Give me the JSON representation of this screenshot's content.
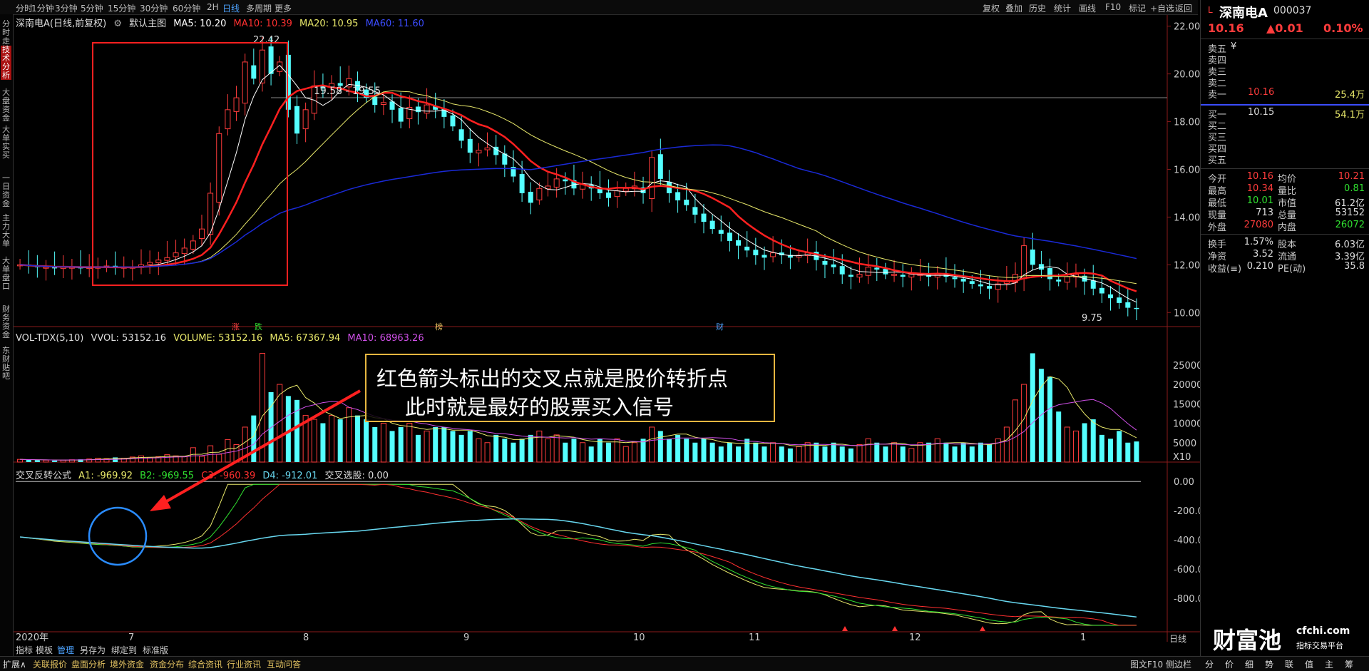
{
  "toolbar": {
    "periods": [
      "分时",
      "1分钟",
      "3分钟",
      "5分钟",
      "15分钟",
      "30分钟",
      "60分钟",
      "2H",
      "日线",
      "多周期",
      "更多"
    ],
    "active_period": "日线",
    "right_buttons": [
      "复权",
      "叠加",
      "历史",
      "统计",
      "画线",
      "F10",
      "标记",
      "+自选",
      "返回"
    ]
  },
  "side_nav": [
    "分时走势",
    "技术分析",
    "大盘资金",
    "大单实买",
    "一日资金",
    "主力大单",
    "大单盘口",
    "财务资金",
    "东财贴吧"
  ],
  "side_nav_active": "技术分析",
  "main_legend": {
    "stock": "深南电A(日线,前复权)",
    "mode": "默认主图",
    "ma5": "MA5: 10.20",
    "ma10": "MA10: 10.39",
    "ma20": "MA20: 10.95",
    "ma60": "MA60: 11.60"
  },
  "price_axis": [
    "22.00",
    "20.00",
    "18.00",
    "16.00",
    "14.00",
    "12.00",
    "10.00"
  ],
  "price_annotations": {
    "high": "22.42",
    "range": "19.58 - 19.55",
    "low": "9.75"
  },
  "event_markers": [
    "涨",
    "跌",
    "榜",
    "财"
  ],
  "vol_legend": {
    "name": "VOL-TDX(5,10)",
    "vvol": "VVOL: 53152.16",
    "volume": "VOLUME: 53152.16",
    "ma5": "MA5: 67367.94",
    "ma10": "MA10: 68963.26"
  },
  "vol_axis": [
    "25000",
    "20000",
    "15000",
    "10000",
    "5000",
    "X10"
  ],
  "ind_legend": {
    "name": "交叉反转公式",
    "a1": "A1: -969.92",
    "b2": "B2: -969.55",
    "c3": "C3: -960.39",
    "d4": "D4: -912.01",
    "pick": "交叉选股: 0.00"
  },
  "ind_axis": [
    "0.00",
    "-200.0",
    "-400.0",
    "-600.0",
    "-800.0"
  ],
  "date_axis": [
    "2020年",
    "7",
    "8",
    "9",
    "10",
    "11",
    "12",
    "1"
  ],
  "period_label": "日线",
  "bottom_tabs": [
    "指标",
    "模板",
    "管理",
    "另存为",
    "绑定到",
    "标准版"
  ],
  "bottom_tabs_active": "管理",
  "annotation": {
    "line1": "红色箭头标出的交叉点就是股价转折点",
    "line2": "此时就是最好的股票买入信号"
  },
  "quote": {
    "name": "深南电A",
    "code": "000037",
    "market": "L",
    "price": "10.16",
    "change": "▲0.01",
    "change_pct": "0.10%",
    "asks": [
      {
        "label": "卖五",
        "price": "",
        "vol": ""
      },
      {
        "label": "卖四",
        "price": "",
        "vol": ""
      },
      {
        "label": "卖三",
        "price": "",
        "vol": ""
      },
      {
        "label": "卖二",
        "price": "",
        "vol": ""
      },
      {
        "label": "卖一",
        "price": "10.16",
        "vol": "25.4万"
      }
    ],
    "ask_unit": "¥",
    "bids": [
      {
        "label": "买一",
        "price": "10.15",
        "vol": "54.1万"
      },
      {
        "label": "买二",
        "price": "",
        "vol": ""
      },
      {
        "label": "买三",
        "price": "",
        "vol": ""
      },
      {
        "label": "买四",
        "price": "",
        "vol": ""
      },
      {
        "label": "买五",
        "price": "",
        "vol": ""
      }
    ],
    "stats": [
      {
        "k1": "今开",
        "v1": "10.16",
        "k2": "均价",
        "v2": "10.21"
      },
      {
        "k1": "最高",
        "v1": "10.34",
        "k2": "量比",
        "v2": "0.81"
      },
      {
        "k1": "最低",
        "v1": "10.01",
        "k2": "市值",
        "v2": "61.2亿"
      },
      {
        "k1": "现量",
        "v1": "713",
        "k2": "总量",
        "v2": "53152"
      },
      {
        "k1": "外盘",
        "v1": "27080",
        "k2": "内盘",
        "v2": "26072"
      }
    ],
    "stats2": [
      {
        "k1": "换手",
        "v1": "1.57%",
        "k2": "股本",
        "v2": "6.03亿"
      },
      {
        "k1": "净资",
        "v1": "3.52",
        "k2": "流通",
        "v2": "3.39亿"
      },
      {
        "k1": "收益(≡)",
        "v1": "0.210",
        "k2": "PE(动)",
        "v2": "35.8"
      }
    ]
  },
  "logo": {
    "text": "财富池",
    "url": "cfchi.com",
    "slogan": "指标交易平台"
  },
  "status_bar": [
    "扩展∧",
    "关联报价",
    "盘面分析",
    "境外资金",
    "资金分布",
    "综合资讯",
    "行业资讯",
    "互动问答"
  ],
  "status_right": "图文F10 侧边栏",
  "right_tabs": [
    "分",
    "价",
    "细",
    "势",
    "联",
    "值",
    "主",
    "筹"
  ],
  "colors": {
    "up": "#ff3c3c",
    "down": "#54ffff",
    "ma5": "#ffffff",
    "ma10": "#ff2020",
    "ma20": "#e8e86a",
    "ma60": "#1a2ad8",
    "accent": "#4da3ff",
    "gold": "#e6b640"
  },
  "chart_data": {
    "type": "candlestick",
    "note_period": "2020-06 to 2021-01 daily",
    "price_ylim": [
      9.5,
      22.5
    ],
    "close_series": [
      12.0,
      11.95,
      11.9,
      11.9,
      11.85,
      11.9,
      11.9,
      11.85,
      11.9,
      11.9,
      11.95,
      11.9,
      11.9,
      11.9,
      12.0,
      12.1,
      12.2,
      12.3,
      12.5,
      12.7,
      13.0,
      13.5,
      15.0,
      17.5,
      18.5,
      19.0,
      20.5,
      19.8,
      21.0,
      20.0,
      20.5,
      18.5,
      17.5,
      18.5,
      19.5,
      19.4,
      19.6,
      19.5,
      19.8,
      19.3,
      19.0,
      18.7,
      18.8,
      18.5,
      18.0,
      18.6,
      18.4,
      18.7,
      18.5,
      18.2,
      17.8,
      17.2,
      16.7,
      16.8,
      16.9,
      16.6,
      16.2,
      15.7,
      15.0,
      14.6,
      15.2,
      15.3,
      15.6,
      15.5,
      15.2,
      15.4,
      15.2,
      15.0,
      14.8,
      15.1,
      15.2,
      15.3,
      15.0,
      16.5,
      15.6,
      15.0,
      14.7,
      14.5,
      14.1,
      13.8,
      13.5,
      13.3,
      13.0,
      12.8,
      12.6,
      12.4,
      12.3,
      12.5,
      12.4,
      12.3,
      12.4,
      12.5,
      12.2,
      12.0,
      11.9,
      11.6,
      11.5,
      11.6,
      11.9,
      11.8,
      11.6,
      11.6,
      11.5,
      11.6,
      11.6,
      11.5,
      11.6,
      11.5,
      11.4,
      11.3,
      11.2,
      11.1,
      11.0,
      11.2,
      11.3,
      11.6,
      12.8,
      12.0,
      11.8,
      11.4,
      11.3,
      11.5,
      11.6,
      11.3,
      11.0,
      10.8,
      10.6,
      10.4,
      10.2,
      10.16
    ],
    "volume_series": [
      700,
      600,
      500,
      500,
      400,
      500,
      600,
      700,
      800,
      1000,
      900,
      1200,
      1000,
      1300,
      1600,
      1100,
      1400,
      1900,
      1600,
      1400,
      3700,
      1500,
      4200,
      2000,
      5800,
      4500,
      9000,
      12000,
      28000,
      18000,
      20000,
      17000,
      16000,
      12000,
      11000,
      10000,
      12000,
      11000,
      14000,
      12000,
      11000,
      9000,
      10000,
      8000,
      9000,
      10000,
      7000,
      8000,
      9000,
      9000,
      8000,
      7000,
      8000,
      6000,
      5000,
      7000,
      6000,
      5000,
      6000,
      7000,
      8000,
      6000,
      7000,
      5000,
      6000,
      5000,
      4000,
      6000,
      5000,
      6000,
      4000,
      5000,
      6000,
      9000,
      8000,
      6000,
      7000,
      6000,
      5000,
      6000,
      5000,
      4000,
      5000,
      4000,
      6000,
      5000,
      4000,
      5000,
      4000,
      3500,
      4000,
      5000,
      5000,
      4000,
      5000,
      4000,
      3500,
      4500,
      6000,
      5000,
      4000,
      5000,
      4000,
      3500,
      5000,
      5000,
      6000,
      5000,
      4000,
      5000,
      4000,
      5000,
      4500,
      6000,
      9000,
      16000,
      20000,
      28000,
      24000,
      22000,
      13000,
      9000,
      8000,
      10000,
      11000,
      7000,
      6000,
      8000,
      5000,
      5300
    ],
    "indicator_ylim": [
      -1000,
      50
    ],
    "x_ticks": [
      "2020年",
      "7",
      "8",
      "9",
      "10",
      "11",
      "12",
      "1"
    ]
  }
}
